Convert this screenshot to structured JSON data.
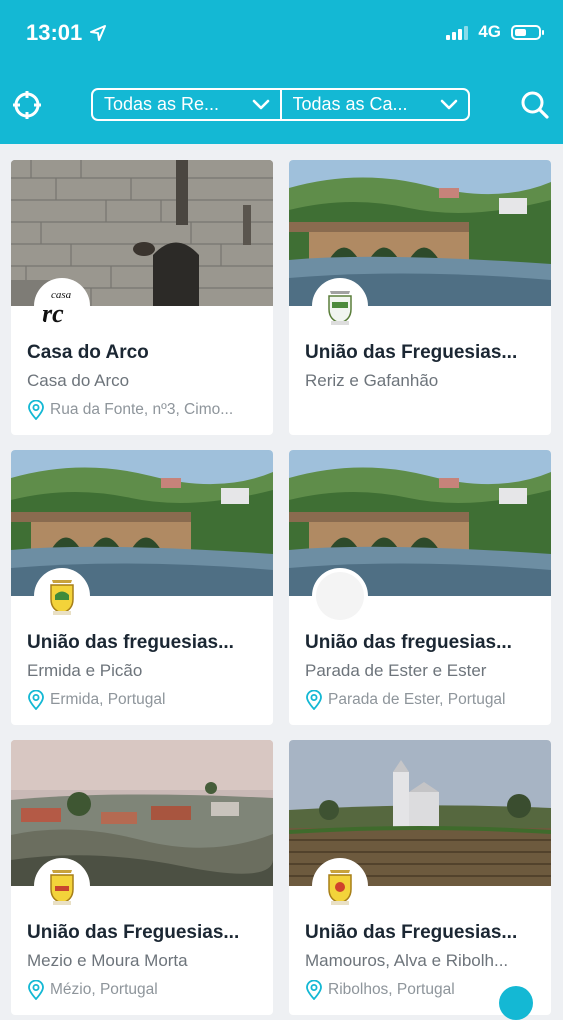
{
  "status_bar": {
    "time": "13:01",
    "network": "4G"
  },
  "filters": [
    {
      "label": "Todas as Re..."
    },
    {
      "label": "Todas as Ca..."
    }
  ],
  "cards": [
    {
      "title": "Casa do Arco",
      "subtitle": "Casa do Arco",
      "address": "Rua da Fonte, nº3, Cimo...",
      "photo": "stone-house",
      "logo": "casa-arco-logo",
      "logo_text": "casa arc"
    },
    {
      "title": "União das Freguesias...",
      "subtitle": "Reriz e Gafanhão",
      "address": "",
      "photo": "river-bridge",
      "logo": "parish-crest-icon"
    },
    {
      "title": "União das freguesias...",
      "subtitle": "Ermida e Picão",
      "address": "Ermida, Portugal",
      "photo": "river-bridge",
      "logo": "parish-crest-icon"
    },
    {
      "title": "União das freguesias...",
      "subtitle": "Parada de Ester e Ester",
      "address": "Parada de Ester, Portugal",
      "photo": "river-bridge",
      "logo": "blank-logo"
    },
    {
      "title": "União das Freguesias...",
      "subtitle": "Mezio e Moura Morta",
      "address": "Mézio, Portugal",
      "photo": "village-mist",
      "logo": "parish-crest-icon"
    },
    {
      "title": "União das Freguesias...",
      "subtitle": "Mamouros, Alva e Ribolh...",
      "address": "Ribolhos, Portugal",
      "photo": "church-vineyard",
      "logo": "parish-crest-icon"
    }
  ],
  "colors": {
    "header": "#14b8d4",
    "title": "#1b2733",
    "subtitle": "#6d747b",
    "pin": "#14b8d4"
  }
}
